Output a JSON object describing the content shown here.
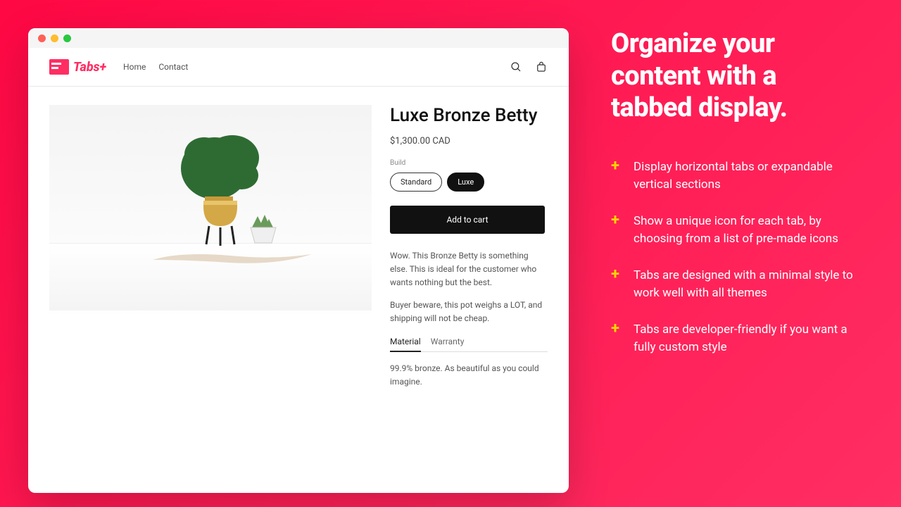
{
  "brand": {
    "text": "Tabs+"
  },
  "nav": {
    "home": "Home",
    "contact": "Contact"
  },
  "product": {
    "title": "Luxe Bronze Betty",
    "price": "$1,300.00 CAD",
    "build_label": "Build",
    "option_standard": "Standard",
    "option_luxe": "Luxe",
    "add_to_cart": "Add to cart",
    "desc1": "Wow. This Bronze Betty is something else. This is ideal for the customer who wants nothing but the best.",
    "desc2": "Buyer beware, this pot weighs a LOT, and shipping will not be cheap.",
    "tab_material": "Material",
    "tab_warranty": "Warranty",
    "tab_content": "99.9% bronze. As beautiful as you could imagine."
  },
  "side": {
    "headline": "Organize your content with a tabbed display.",
    "f1": "Display horizontal tabs or expandable vertical sections",
    "f2": "Show a unique icon for each tab, by choosing from a list of pre-made icons",
    "f3": "Tabs are designed with a minimal style to work well with all themes",
    "f4": "Tabs are developer-friendly if you want a fully custom style"
  },
  "plus": "+"
}
